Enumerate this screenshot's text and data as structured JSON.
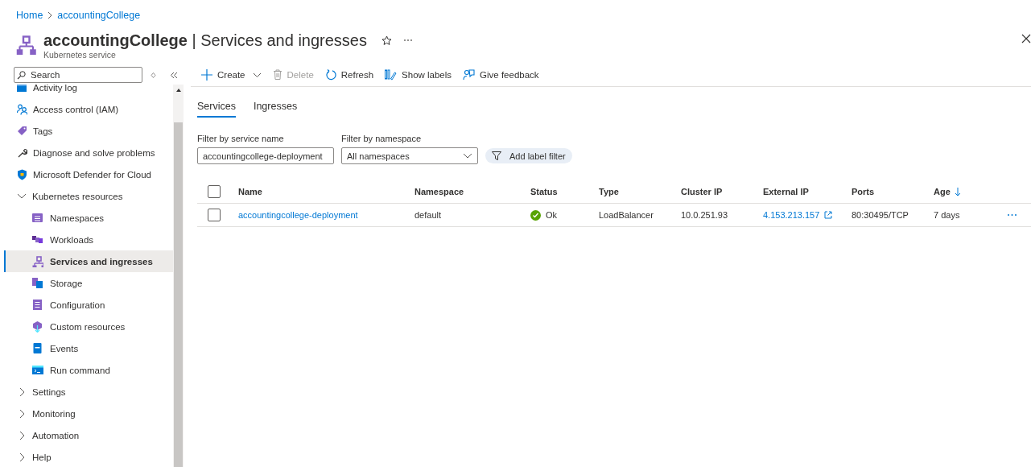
{
  "breadcrumb": [
    {
      "label": "Home"
    },
    {
      "label": "accountingCollege"
    }
  ],
  "header": {
    "title": "**accountingCollege** | Services and ingresses",
    "subtitle": "Kubernetes service"
  },
  "sidebar": {
    "search": {
      "placeholder": "Search"
    },
    "items": [
      {
        "kind": "item",
        "label": "Activity log",
        "selected": false
      },
      {
        "kind": "item",
        "label": "Access control (IAM)",
        "selected": false
      },
      {
        "kind": "item",
        "label": "Tags",
        "selected": false
      },
      {
        "kind": "item",
        "label": "Diagnose and solve problems",
        "selected": false
      },
      {
        "kind": "item",
        "label": "Microsoft Defender for Cloud",
        "selected": false
      },
      {
        "kind": "group",
        "label": "Kubernetes resources",
        "expanded": true,
        "children": [
          {
            "label": "Namespaces",
            "selected": false
          },
          {
            "label": "Workloads",
            "selected": false
          },
          {
            "label": "Services and ingresses",
            "selected": true
          },
          {
            "label": "Storage",
            "selected": false
          },
          {
            "label": "Configuration",
            "selected": false
          },
          {
            "label": "Custom resources",
            "selected": false
          },
          {
            "label": "Events",
            "selected": false
          },
          {
            "label": "Run command",
            "selected": false
          }
        ]
      },
      {
        "kind": "group",
        "label": "Settings",
        "expanded": false
      },
      {
        "kind": "group",
        "label": "Monitoring",
        "expanded": false
      },
      {
        "kind": "group",
        "label": "Automation",
        "expanded": false
      },
      {
        "kind": "group",
        "label": "Help",
        "expanded": false
      }
    ]
  },
  "toolbar": [
    {
      "label": "Create",
      "disabled": false
    },
    {
      "label": "Delete",
      "disabled": true
    },
    {
      "label": "Refresh",
      "disabled": false
    },
    {
      "label": "Show labels",
      "disabled": false
    },
    {
      "label": "Give feedback",
      "disabled": false
    }
  ],
  "tabs": [
    {
      "label": "Services",
      "selected": true
    },
    {
      "label": "Ingresses",
      "selected": false
    }
  ],
  "filters": {
    "service_name": {
      "label": "Filter by service name",
      "value": "accountingcollege-deployment"
    },
    "namespace": {
      "label": "Filter by namespace",
      "value": "All namespaces"
    },
    "label_filter": "Add label filter"
  },
  "table": {
    "columns": [
      {
        "label": "Name",
        "sorted": false
      },
      {
        "label": "Namespace",
        "sorted": false
      },
      {
        "label": "Status",
        "sorted": false
      },
      {
        "label": "Type",
        "sorted": false
      },
      {
        "label": "Cluster IP",
        "sorted": false
      },
      {
        "label": "External IP",
        "sorted": false
      },
      {
        "label": "Ports",
        "sorted": false
      },
      {
        "label": "Age",
        "sorted": true
      }
    ],
    "all_checked": false,
    "rows": [
      {
        "checked": false,
        "name": "accountingcollege-deployment",
        "namespace": "default",
        "status": {
          "kind": "ok",
          "label": "Ok"
        },
        "type": "LoadBalancer",
        "cluster_ip": "10.0.251.93",
        "external_ip": "4.153.213.157",
        "ports": "80:30495/TCP",
        "age": "7 days"
      }
    ]
  }
}
